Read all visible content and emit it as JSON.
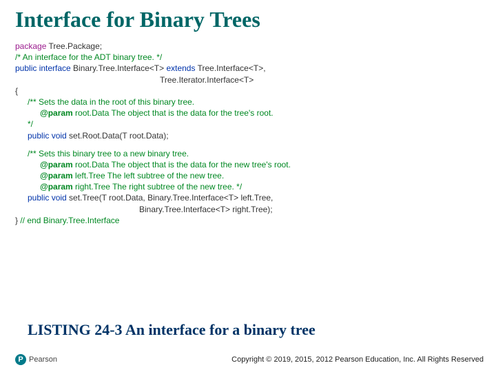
{
  "title": "Interface for Binary Trees",
  "code": {
    "l1_kw": "package",
    "l1_rest": " Tree.Package;",
    "l2": "/*   An interface for the ADT binary tree. */",
    "l3_a": "public interface",
    "l3_b": " Binary.Tree.Interface<T> ",
    "l3_c": "extends",
    "l3_d": " Tree.Interface<T>,",
    "l4": "Tree.Iterator.Interface<T>",
    "l5": "{",
    "l6": "/** Sets the data in the root of this binary tree.",
    "l7_a": "@param",
    "l7_b": " root.Data  The object that is the data for the tree's root.",
    "l8": "*/",
    "l9_a": "public void",
    "l9_b": " set.Root.Data(T root.Data);",
    "l10": "/** Sets this binary tree to a new binary tree.",
    "l11_a": "@param",
    "l11_b": " root.Data   The object that is the data for the new tree's root.",
    "l12_a": "@param",
    "l12_b": " left.Tree   The left subtree of the new tree.",
    "l13_a": "@param",
    "l13_b": " right.Tree  The right subtree of the new tree. */",
    "l14_a": "public void",
    "l14_b": " set.Tree(T root.Data, Binary.Tree.Interface<T> left.Tree,",
    "l15": "Binary.Tree.Interface<T> right.Tree);",
    "l16_a": "} ",
    "l16_b": "// end Binary.Tree.Interface"
  },
  "listing": "LISTING 24-3 An interface for a binary tree",
  "logo": {
    "letter": "P",
    "name": "Pearson"
  },
  "copyright": "Copyright © 2019, 2015, 2012 Pearson Education, Inc. All Rights Reserved"
}
